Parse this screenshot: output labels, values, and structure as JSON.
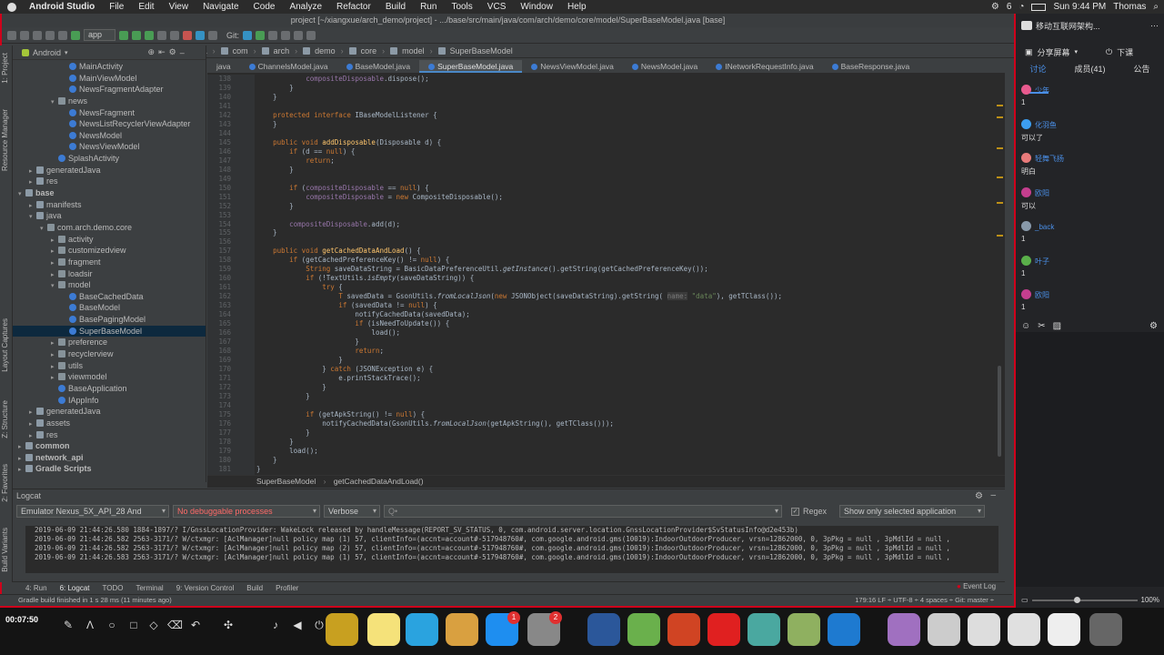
{
  "menubar": {
    "app_name": "Android Studio",
    "items": [
      "File",
      "Edit",
      "View",
      "Navigate",
      "Code",
      "Analyze",
      "Refactor",
      "Build",
      "Run",
      "Tools",
      "VCS",
      "Window",
      "Help"
    ],
    "badge_count": "6",
    "clock": "Sun 9:44 PM",
    "user": "Thomas"
  },
  "window": {
    "title": "project [~/xiangxue/arch_demo/project] - .../base/src/main/java/com/arch/demo/core/model/SuperBaseModel.java [base]"
  },
  "toolbar": {
    "run_config": "app",
    "git_label": "Git:"
  },
  "breadcrumb_nav": [
    "project",
    "base",
    "src",
    "main",
    "java",
    "com",
    "arch",
    "demo",
    "core",
    "model",
    "SuperBaseModel"
  ],
  "project_panel": {
    "view_mode": "Android",
    "tree": [
      {
        "label": "MainActivity",
        "indent": 5,
        "type": "class",
        "arrow": ""
      },
      {
        "label": "MainViewModel",
        "indent": 5,
        "type": "class",
        "arrow": ""
      },
      {
        "label": "NewsFragmentAdapter",
        "indent": 5,
        "type": "class",
        "arrow": ""
      },
      {
        "label": "news",
        "indent": 4,
        "type": "pkg",
        "arrow": "▾"
      },
      {
        "label": "NewsFragment",
        "indent": 5,
        "type": "class",
        "arrow": ""
      },
      {
        "label": "NewsListRecyclerViewAdapter",
        "indent": 5,
        "type": "class",
        "arrow": ""
      },
      {
        "label": "NewsModel",
        "indent": 5,
        "type": "class",
        "arrow": ""
      },
      {
        "label": "NewsViewModel",
        "indent": 5,
        "type": "class",
        "arrow": ""
      },
      {
        "label": "SplashActivity",
        "indent": 4,
        "type": "class",
        "arrow": ""
      },
      {
        "label": "generatedJava",
        "indent": 2,
        "type": "folder",
        "arrow": "▸"
      },
      {
        "label": "res",
        "indent": 2,
        "type": "folder",
        "arrow": "▸"
      },
      {
        "label": "base",
        "indent": 1,
        "type": "folder",
        "arrow": "▾"
      },
      {
        "label": "manifests",
        "indent": 2,
        "type": "folder",
        "arrow": "▸"
      },
      {
        "label": "java",
        "indent": 2,
        "type": "folder",
        "arrow": "▾"
      },
      {
        "label": "com.arch.demo.core",
        "indent": 3,
        "type": "pkg",
        "arrow": "▾"
      },
      {
        "label": "activity",
        "indent": 4,
        "type": "pkg",
        "arrow": "▸"
      },
      {
        "label": "customizedview",
        "indent": 4,
        "type": "pkg",
        "arrow": "▸"
      },
      {
        "label": "fragment",
        "indent": 4,
        "type": "pkg",
        "arrow": "▸"
      },
      {
        "label": "loadsir",
        "indent": 4,
        "type": "pkg",
        "arrow": "▸"
      },
      {
        "label": "model",
        "indent": 4,
        "type": "pkg",
        "arrow": "▾"
      },
      {
        "label": "BaseCachedData",
        "indent": 5,
        "type": "class",
        "arrow": ""
      },
      {
        "label": "BaseModel",
        "indent": 5,
        "type": "class",
        "arrow": ""
      },
      {
        "label": "BasePagingModel",
        "indent": 5,
        "type": "class",
        "arrow": ""
      },
      {
        "label": "SuperBaseModel",
        "indent": 5,
        "type": "class",
        "arrow": "",
        "selected": true
      },
      {
        "label": "preference",
        "indent": 4,
        "type": "pkg",
        "arrow": "▸"
      },
      {
        "label": "recyclerview",
        "indent": 4,
        "type": "pkg",
        "arrow": "▸"
      },
      {
        "label": "utils",
        "indent": 4,
        "type": "pkg",
        "arrow": "▸"
      },
      {
        "label": "viewmodel",
        "indent": 4,
        "type": "pkg",
        "arrow": "▸"
      },
      {
        "label": "BaseApplication",
        "indent": 4,
        "type": "class",
        "arrow": ""
      },
      {
        "label": "IAppInfo",
        "indent": 4,
        "type": "class",
        "arrow": ""
      },
      {
        "label": "generatedJava",
        "indent": 2,
        "type": "folder",
        "arrow": "▸"
      },
      {
        "label": "assets",
        "indent": 2,
        "type": "folder",
        "arrow": "▸"
      },
      {
        "label": "res",
        "indent": 2,
        "type": "folder",
        "arrow": "▸"
      },
      {
        "label": "common",
        "indent": 1,
        "type": "folder",
        "arrow": "▸"
      },
      {
        "label": "network_api",
        "indent": 1,
        "type": "folder",
        "arrow": "▸"
      },
      {
        "label": "Gradle Scripts",
        "indent": 1,
        "type": "folder",
        "arrow": "▸"
      }
    ]
  },
  "left_strip": [
    "1: Project",
    "Resource Manager",
    "Layout Captures",
    "Z: Structure",
    "2: Favorites",
    "Build Variants"
  ],
  "editor_tabs": [
    {
      "label": "java",
      "active": false
    },
    {
      "label": "ChannelsModel.java",
      "active": false
    },
    {
      "label": "BaseModel.java",
      "active": false
    },
    {
      "label": "SuperBaseModel.java",
      "active": true
    },
    {
      "label": "NewsViewModel.java",
      "active": false
    },
    {
      "label": "NewsModel.java",
      "active": false
    },
    {
      "label": "INetworkRequestInfo.java",
      "active": false
    },
    {
      "label": "BaseResponse.java",
      "active": false
    }
  ],
  "code": {
    "line_numbers": [
      "138",
      "139",
      "140",
      "141",
      "142",
      "143",
      "144",
      "145",
      "146",
      "147",
      "148",
      "149",
      "150",
      "151",
      "152",
      "153",
      "154",
      "155",
      "156",
      "157",
      "158",
      "159",
      "160",
      "161",
      "162",
      "163",
      "164",
      "165",
      "166",
      "167",
      "168",
      "169",
      "170",
      "171",
      "172",
      "173",
      "174",
      "175",
      "176",
      "177",
      "178",
      "179",
      "180",
      "181"
    ],
    "lines": [
      "            compositeDisposable.dispose();",
      "        }",
      "    }",
      "",
      "    protected interface IBaseModelListener {",
      "    }",
      "",
      "    public void addDisposable(Disposable d) {",
      "        if (d == null) {",
      "            return;",
      "        }",
      "",
      "        if (compositeDisposable == null) {",
      "            compositeDisposable = new CompositeDisposable();",
      "        }",
      "",
      "        compositeDisposable.add(d);",
      "    }",
      "",
      "    public void getCachedDataAndLoad() {",
      "        if (getCachedPreferenceKey() != null) {",
      "            String saveDataString = BasicDataPreferenceUtil.getInstance().getString(getCachedPreferenceKey());",
      "            if (!TextUtils.isEmpty(saveDataString)) {",
      "                try {",
      "                    T savedData = GsonUtils.fromLocalJson(new JSONObject(saveDataString).getString( name: \"data\"), getTClass());",
      "                    if (savedData != null) {",
      "                        notifyCachedData(savedData);",
      "                        if (isNeedToUpdate()) {",
      "                            load();",
      "                        }",
      "                        return;",
      "                    }",
      "                } catch (JSONException e) {",
      "                    e.printStackTrace();",
      "                }",
      "            }",
      "",
      "            if (getApkString() != null) {",
      "                notifyCachedData(GsonUtils.fromLocalJson(getApkString(), getTClass()));",
      "            }",
      "        }",
      "        load();",
      "    }",
      "}"
    ]
  },
  "editor_breadcrumb": {
    "class": "SuperBaseModel",
    "method": "getCachedDataAndLoad()"
  },
  "logcat": {
    "title": "Logcat",
    "device": "Emulator Nexus_5X_API_28 And",
    "process": "No debuggable processes",
    "level": "Verbose",
    "search_placeholder": "Q•",
    "regex_label": "Regex",
    "filter": "Show only selected application",
    "lines": [
      "2019-06-09 21:44:26.580 1884-1897/? I/GnssLocationProvider: WakeLock released by handleMessage(REPORT_SV_STATUS, 0, com.android.server.location.GnssLocationProvider$SvStatusInfo@d2e453b)",
      "2019-06-09 21:44:26.582 2563-3171/? W/ctxmgr: [AclManager]null policy map (1) 57, clientInfo=(accnt=account#-517948760#, com.google.android.gms(10019):IndoorOutdoorProducer, vrsn=12862000, 0, 3pPkg = null , 3pMdlId = null ,",
      "2019-06-09 21:44:26.582 2563-3171/? W/ctxmgr: [AclManager]null policy map (2) 57, clientInfo=(accnt=account#-517948760#, com.google.android.gms(10019):IndoorOutdoorProducer, vrsn=12862000, 0, 3pPkg = null , 3pMdlId = null ,",
      "2019-06-09 21:44:26.583 2563-3171/? W/ctxmgr: [AclManager]null policy map (1) 57, clientInfo=(accnt=account#-517948760#, com.google.android.gms(10019):IndoorOutdoorProducer, vrsn=12862000, 0, 3pPkg = null , 3pMdlId = null ,"
    ]
  },
  "bottom_tabs": [
    "4: Run",
    "6: Logcat",
    "TODO",
    "Terminal",
    "9: Version Control",
    "Build",
    "Profiler"
  ],
  "event_log": "Event Log",
  "status": {
    "message": "Gradle build finished in 1 s 28 ms (11 minutes ago)",
    "right": "179:16   LF ÷   UTF-8 ÷   4 spaces ÷   Git: master ÷"
  },
  "right_panel": {
    "title": "移动互联网架构...",
    "share_label": "分享屏幕",
    "leave_label": "下课",
    "tabs": [
      "讨论",
      "成员(41)",
      "公告"
    ],
    "messages": [
      {
        "name": "少年",
        "text": "1"
      },
      {
        "name": "化羽鱼",
        "text": "可以了"
      },
      {
        "name": "轻舞飞扬",
        "text": "明白"
      },
      {
        "name": "欧阳",
        "text": "可以"
      },
      {
        "name": "_back",
        "text": "1"
      },
      {
        "name": "叶子",
        "text": "1"
      },
      {
        "name": "欧阳",
        "text": "1"
      }
    ],
    "zoom_label": "100%"
  },
  "dock": {
    "timer": "00:07:50"
  },
  "colors": {
    "accent_red": "#d0021b",
    "editor_bg": "#2b2b2b",
    "keyword": "#cc7832",
    "method": "#ffc66d",
    "field": "#9876aa"
  }
}
